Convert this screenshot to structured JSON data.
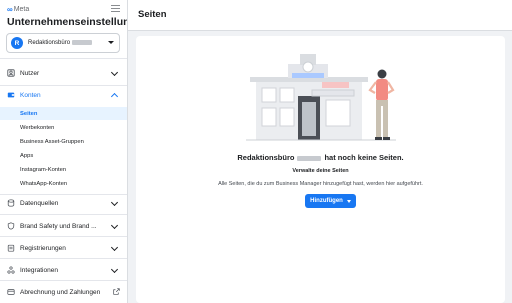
{
  "sidebar": {
    "brand": "Meta",
    "app_title": "Unternehmenseinstellungen",
    "account": {
      "avatar_letter": "R",
      "name": "Redaktionsbüro"
    },
    "nav": [
      {
        "id": "nutzer",
        "label": "Nutzer",
        "icon": "users-icon"
      },
      {
        "id": "konten",
        "label": "Konten",
        "icon": "wallet-icon"
      },
      {
        "id": "datenquellen",
        "label": "Datenquellen",
        "icon": "data-sources-icon"
      },
      {
        "id": "brand-safety",
        "label": "Brand Safety und Brand ...",
        "icon": "shield-icon"
      },
      {
        "id": "registrierungen",
        "label": "Registrierungen",
        "icon": "clipboard-icon"
      },
      {
        "id": "integrationen",
        "label": "Integrationen",
        "icon": "integrations-icon"
      },
      {
        "id": "abrechnung",
        "label": "Abrechnung und Zahlungen",
        "icon": "card-icon"
      }
    ],
    "konten_items": [
      "Seiten",
      "Werbekonten",
      "Business Asset-Gruppen",
      "Apps",
      "Instagram-Konten",
      "WhatsApp-Konten"
    ],
    "selected_item": "Seiten"
  },
  "header": {
    "title": "Seiten"
  },
  "empty_state": {
    "title_prefix": "Redaktionsbüro",
    "title_suffix": "hat noch keine Seiten.",
    "subtitle": "Verwalte deine Seiten",
    "description": "Alle Seiten, die du zum Business Manager hinzugefügt hast, werden hier aufgeführt.",
    "button_label": "Hinzufügen"
  },
  "colors": {
    "accent": "#1877f2",
    "selected_bg": "#e7f3ff",
    "page_bg": "#f0f2f5"
  }
}
